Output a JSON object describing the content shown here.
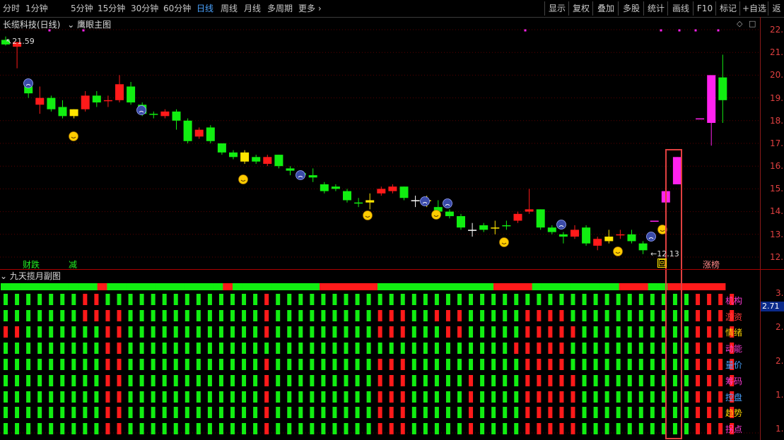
{
  "toolbar": {
    "periods": [
      "分时",
      "1分钟",
      "5分钟",
      "15分钟",
      "30分钟",
      "60分钟",
      "日线",
      "周线",
      "月线",
      "多周期",
      "更多"
    ],
    "active_period": "日线",
    "right_tabs": [
      "显示",
      "复权",
      "叠加",
      "多股",
      "统计",
      "画线",
      "F10",
      "标记",
      "+自选",
      "返"
    ]
  },
  "chart": {
    "stock": "长缆科技(日线)",
    "indicator": "鹰眼主图",
    "high_label": "21.59",
    "low_label": "12.13",
    "price_axis": [
      "22.",
      "21.",
      "20.",
      "19.",
      "18.",
      "17.",
      "16.",
      "15.",
      "14.",
      "13.",
      "12."
    ],
    "signals": {
      "caidie": "财跌",
      "jian": "减",
      "hui": "回",
      "zhangbang": "涨榜"
    },
    "chart_data": {
      "type": "candlestick",
      "ylim": [
        11.9,
        22.2
      ],
      "candles": [
        {
          "o": 21.35,
          "c": 21.55,
          "h": 21.7,
          "l": 21.3,
          "col": "g"
        },
        {
          "o": 21.25,
          "c": 21.45,
          "h": 21.45,
          "l": 20.3,
          "col": "r"
        },
        {
          "o": 19.2,
          "c": 19.5,
          "h": 19.7,
          "l": 19.0,
          "col": "g"
        },
        {
          "o": 18.7,
          "c": 19.0,
          "h": 19.5,
          "l": 18.3,
          "col": "r"
        },
        {
          "o": 19.0,
          "c": 18.5,
          "h": 19.1,
          "l": 18.4,
          "col": "g"
        },
        {
          "o": 18.6,
          "c": 18.2,
          "h": 18.9,
          "l": 18.1,
          "col": "g"
        },
        {
          "o": 18.5,
          "c": 18.2,
          "h": 18.5,
          "l": 18.1,
          "col": "y"
        },
        {
          "o": 18.5,
          "c": 19.1,
          "h": 19.3,
          "l": 18.4,
          "col": "r"
        },
        {
          "o": 18.8,
          "c": 19.1,
          "h": 19.3,
          "l": 18.6,
          "col": "g"
        },
        {
          "o": 18.9,
          "c": 18.9,
          "h": 19.1,
          "l": 18.6,
          "col": "r"
        },
        {
          "o": 18.9,
          "c": 19.6,
          "h": 20.0,
          "l": 18.8,
          "col": "r"
        },
        {
          "o": 19.5,
          "c": 18.8,
          "h": 19.7,
          "l": 18.7,
          "col": "g"
        },
        {
          "o": 18.7,
          "c": 18.3,
          "h": 18.8,
          "l": 18.2,
          "col": "g"
        },
        {
          "o": 18.3,
          "c": 18.3,
          "h": 18.4,
          "l": 18.1,
          "col": "g"
        },
        {
          "o": 18.2,
          "c": 18.4,
          "h": 18.5,
          "l": 18.1,
          "col": "r"
        },
        {
          "o": 18.4,
          "c": 18.0,
          "h": 18.5,
          "l": 17.6,
          "col": "g"
        },
        {
          "o": 18.0,
          "c": 17.1,
          "h": 18.1,
          "l": 17.0,
          "col": "g"
        },
        {
          "o": 17.3,
          "c": 17.6,
          "h": 17.7,
          "l": 17.2,
          "col": "r"
        },
        {
          "o": 17.7,
          "c": 17.1,
          "h": 17.8,
          "l": 17.0,
          "col": "g"
        },
        {
          "o": 17.0,
          "c": 16.6,
          "h": 17.0,
          "l": 16.5,
          "col": "g"
        },
        {
          "o": 16.6,
          "c": 16.4,
          "h": 16.7,
          "l": 16.3,
          "col": "g"
        },
        {
          "o": 16.6,
          "c": 16.2,
          "h": 16.7,
          "l": 16.1,
          "col": "y"
        },
        {
          "o": 16.4,
          "c": 16.2,
          "h": 16.5,
          "l": 16.1,
          "col": "g"
        },
        {
          "o": 16.1,
          "c": 16.4,
          "h": 16.5,
          "l": 16.0,
          "col": "r"
        },
        {
          "o": 16.5,
          "c": 16.0,
          "h": 16.5,
          "l": 15.9,
          "col": "g"
        },
        {
          "o": 15.9,
          "c": 15.8,
          "h": 16.0,
          "l": 15.6,
          "col": "g"
        },
        {
          "o": 15.7,
          "c": 15.6,
          "h": 15.8,
          "l": 15.5,
          "col": "g"
        },
        {
          "o": 15.6,
          "c": 15.5,
          "h": 15.9,
          "l": 15.3,
          "col": "g"
        },
        {
          "o": 15.2,
          "c": 14.9,
          "h": 15.3,
          "l": 14.8,
          "col": "g"
        },
        {
          "o": 15.1,
          "c": 15.0,
          "h": 15.2,
          "l": 14.9,
          "col": "g"
        },
        {
          "o": 14.9,
          "c": 14.5,
          "h": 15.0,
          "l": 14.4,
          "col": "g"
        },
        {
          "o": 14.4,
          "c": 14.4,
          "h": 14.6,
          "l": 14.2,
          "col": "g"
        },
        {
          "o": 14.4,
          "c": 14.5,
          "h": 14.8,
          "l": 14.1,
          "col": "y"
        },
        {
          "o": 14.8,
          "c": 15.0,
          "h": 15.1,
          "l": 14.7,
          "col": "r"
        },
        {
          "o": 14.9,
          "c": 15.1,
          "h": 15.2,
          "l": 14.8,
          "col": "r"
        },
        {
          "o": 15.1,
          "c": 14.6,
          "h": 15.1,
          "l": 14.5,
          "col": "g"
        },
        {
          "o": 14.5,
          "c": 14.5,
          "h": 14.7,
          "l": 14.2,
          "col": "w"
        },
        {
          "o": 14.5,
          "c": 14.5,
          "h": 14.7,
          "l": 14.2,
          "col": "y"
        },
        {
          "o": 14.2,
          "c": 14.0,
          "h": 14.5,
          "l": 13.9,
          "col": "g"
        },
        {
          "o": 14.0,
          "c": 13.8,
          "h": 14.1,
          "l": 13.7,
          "col": "g"
        },
        {
          "o": 13.8,
          "c": 13.3,
          "h": 13.9,
          "l": 13.2,
          "col": "g"
        },
        {
          "o": 13.2,
          "c": 13.2,
          "h": 13.5,
          "l": 12.9,
          "col": "w"
        },
        {
          "o": 13.2,
          "c": 13.4,
          "h": 13.5,
          "l": 13.1,
          "col": "g"
        },
        {
          "o": 13.3,
          "c": 13.3,
          "h": 13.6,
          "l": 13.0,
          "col": "y"
        },
        {
          "o": 13.4,
          "c": 13.4,
          "h": 13.6,
          "l": 13.2,
          "col": "g"
        },
        {
          "o": 13.6,
          "c": 13.9,
          "h": 14.0,
          "l": 13.5,
          "col": "r"
        },
        {
          "o": 14.0,
          "c": 14.1,
          "h": 15.0,
          "l": 13.9,
          "col": "r"
        },
        {
          "o": 14.1,
          "c": 13.3,
          "h": 14.1,
          "l": 13.2,
          "col": "g"
        },
        {
          "o": 13.3,
          "c": 13.1,
          "h": 13.4,
          "l": 13.0,
          "col": "g"
        },
        {
          "o": 13.0,
          "c": 12.9,
          "h": 13.1,
          "l": 12.6,
          "col": "g"
        },
        {
          "o": 12.9,
          "c": 13.2,
          "h": 13.4,
          "l": 12.8,
          "col": "r"
        },
        {
          "o": 13.3,
          "c": 12.6,
          "h": 13.4,
          "l": 12.5,
          "col": "g"
        },
        {
          "o": 12.5,
          "c": 12.8,
          "h": 12.9,
          "l": 12.3,
          "col": "r"
        },
        {
          "o": 12.7,
          "c": 12.9,
          "h": 13.2,
          "l": 12.6,
          "col": "y"
        },
        {
          "o": 13.0,
          "c": 13.0,
          "h": 13.2,
          "l": 12.8,
          "col": "r"
        },
        {
          "o": 13.0,
          "c": 12.7,
          "h": 13.2,
          "l": 12.6,
          "col": "g"
        },
        {
          "o": 12.6,
          "c": 12.3,
          "h": 12.7,
          "l": 12.13,
          "col": "g"
        },
        {
          "o": 13.6,
          "c": 13.6,
          "h": 13.6,
          "l": 13.6,
          "col": "m"
        },
        {
          "o": 14.4,
          "c": 14.9,
          "h": 15.0,
          "l": 13.9,
          "col": "m"
        },
        {
          "o": 15.2,
          "c": 16.4,
          "h": 16.4,
          "l": 15.2,
          "col": "m"
        },
        {
          "o": null,
          "c": null,
          "h": null,
          "l": null,
          "col": "x"
        },
        {
          "o": 18.1,
          "c": 18.1,
          "h": 18.1,
          "l": 18.1,
          "col": "m"
        },
        {
          "o": 17.9,
          "c": 20.0,
          "h": 20.0,
          "l": 16.9,
          "col": "m"
        },
        {
          "o": 18.9,
          "c": 19.9,
          "h": 20.9,
          "l": 17.9,
          "col": "g"
        }
      ]
    }
  },
  "sub": {
    "title": "九天揽月副图",
    "axis": [
      "3.",
      "2.",
      "2.",
      "1.",
      "1."
    ],
    "current_value": "2.71",
    "rows": [
      {
        "label": "机构",
        "color": "#ff3ad6"
      },
      {
        "label": "游资",
        "color": "#ff3a3a"
      },
      {
        "label": "情绪",
        "color": "#ffd400"
      },
      {
        "label": "动能",
        "color": "#ff3ad6"
      },
      {
        "label": "量价",
        "color": "#4aa3ff"
      },
      {
        "label": "筹码",
        "color": "#ff3ad6"
      },
      {
        "label": "控盘",
        "color": "#4aa3ff"
      },
      {
        "label": "趋势",
        "color": "#ffd400"
      },
      {
        "label": "拐点",
        "color": "#ff3ad6"
      }
    ],
    "chart_data": {
      "type": "heatmap",
      "top_bar": "GGGGGGGGGGRGGGGGGGGGGGGRGGGGGGGGGRRRRRRGGGGGGGGGGGGRRRRGGGGGGGGGRRRGGRRRRRR",
      "grid": [
        "GGGGGGGRRGGGGGGGGGGGGGGRGGGGGGGGGGGGGGGGGGGGGGGGGGGGGGGGGGGGGRRRR",
        "GGGGGGGRRRRGGGGGGGGGGGGRGGGGGGGGGRRRGGRRRGGGGGRRRRGGGGGGGGGGGRRRR",
        "RRGGGGGGGRRGGGGGGGGGGGGRGGGGGGGGGRRRGGGRRGGGGGRRRRRGGGGGGGGGGRRRR",
        "GGGGGGGGGRRGGGGGGGGGGGGGGGGGGGGGGGGGGGGGGGGGGRRRRRGGGGGGGGGGGRRRR",
        "GGGGGGGGGRRGGGGGGGGGGGGRGGGGGGGGGRRRGGGGGGGGGGRRRRGGGGGGGGGGGRRRR",
        "GGGGGGGGGRRGGGGGGGGGGGGRGGGGGGGGGRRRGGGGGRGGGGRRRRRGGGGGGGGGGRRRR",
        "GGGGGGGGGRRGGGGGGGGGGGGRGGGGGGGGGRRRGGGGGRGGGGRRRRRGGGGGGGGGGRRRR",
        "GGGGGGGGGRRGGGGGGGGGGGGRGGGGGGGGGRRRGGGGGRGGGGRRRRRGGGGGGGGGGRRRR",
        "GGGGGGGGGRRGGGGGGGGGGGGRGGGGGGGGGRRRGGGGGRGGGGRRRRRGGGGGGGGGGRRRR"
      ]
    }
  },
  "colors": {
    "up": "#ff1a1a",
    "down": "#11ee11",
    "yellow": "#ffe600",
    "magenta": "#ff22ee",
    "grid": "#5a0000",
    "highlight": "#e04040"
  }
}
